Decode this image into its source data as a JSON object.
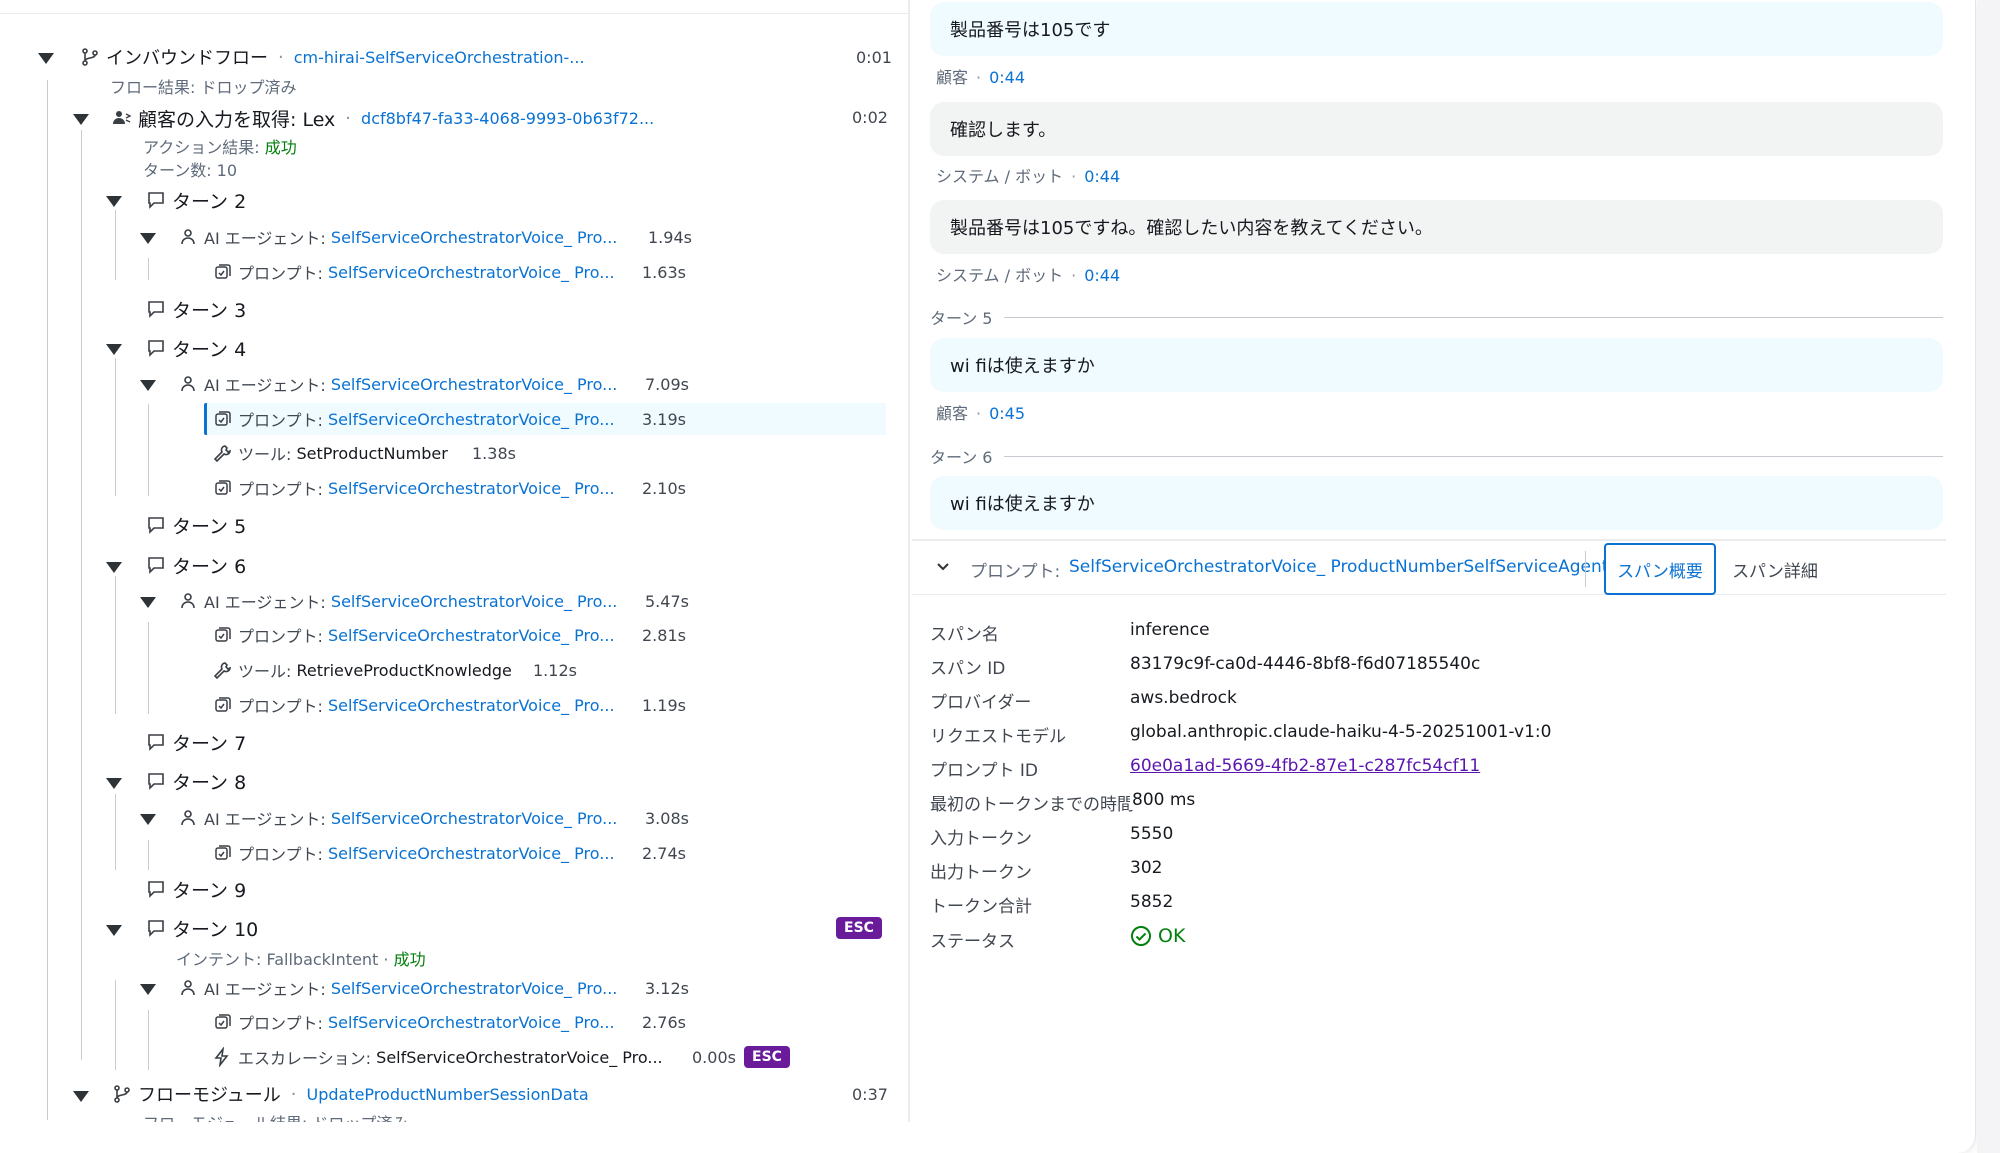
{
  "tree": {
    "inbound": {
      "label": "インバウンドフロー",
      "id": "cm-hirai-SelfServiceOrchestration-...",
      "time": "0:01",
      "result": "フロー結果: ドロップ済み"
    },
    "get_input": {
      "label": "顧客の入力を取得: Lex",
      "id": "dcf8bf47-fa33-4068-9993-0b63f72...",
      "time": "0:02",
      "result_prefix": "アクション結果: ",
      "result_value": "成功",
      "turns": "ターン数: 10"
    },
    "turns": [
      {
        "label": "ターン 2"
      },
      {
        "label": "ターン 3"
      },
      {
        "label": "ターン 4"
      },
      {
        "label": "ターン 5"
      },
      {
        "label": "ターン 6"
      },
      {
        "label": "ターン 7"
      },
      {
        "label": "ターン 8"
      },
      {
        "label": "ターン 9"
      },
      {
        "label": "ターン 10",
        "intent_prefix": "インテント: FallbackIntent · ",
        "intent_value": "成功",
        "badge": "ESC"
      }
    ],
    "agent_label": "AI エージェント:",
    "prompt_label": "プロンプト:",
    "tool_label": "ツール:",
    "escalation_label": "エスカレーション:",
    "agent_name": "SelfServiceOrchestratorVoice_ Pro...",
    "items": {
      "t2_agent": "1.94s",
      "t2_prompt": "1.63s",
      "t4_agent": "7.09s",
      "t4_prompt1": "3.19s",
      "t4_tool": "SetProductNumber",
      "t4_tool_time": "1.38s",
      "t4_prompt2": "2.10s",
      "t6_agent": "5.47s",
      "t6_prompt1": "2.81s",
      "t6_tool": "RetrieveProductKnowledge",
      "t6_tool_time": "1.12s",
      "t6_prompt2": "1.19s",
      "t8_agent": "3.08s",
      "t8_prompt": "2.74s",
      "t10_agent": "3.12s",
      "t10_prompt": "2.76s",
      "t10_esc_name": "SelfServiceOrchestratorVoice_ Pro...",
      "t10_esc_time": "0.00s",
      "t10_esc_badge": "ESC"
    },
    "flow_module": {
      "label": "フローモジュール",
      "id": "UpdateProductNumberSessionData",
      "time": "0:37",
      "result": "フローモジュール結果: ドロップ済み"
    }
  },
  "chat": {
    "m1": {
      "text": "製品番号は105です",
      "who": "顧客",
      "time": "0:44"
    },
    "m2": {
      "text": "確認します。",
      "who": "システム / ボット",
      "time": "0:44"
    },
    "m3": {
      "text": "製品番号は105ですね。確認したい内容を教えてください。",
      "who": "システム / ボット",
      "time": "0:44"
    },
    "turn5": "ターン 5",
    "m4": {
      "text": "wi fiは使えますか",
      "who": "顧客",
      "time": "0:45"
    },
    "turn6": "ターン 6",
    "m5": {
      "text": "wi fiは使えますか"
    }
  },
  "detail": {
    "header_label": "プロンプト:",
    "header_value": "SelfServiceOrchestratorVoice_ ProductNumberSelfServiceAgent",
    "tab_summary": "スパン概要",
    "tab_details": "スパン詳細",
    "rows": [
      {
        "k": "スパン名",
        "v": "inference"
      },
      {
        "k": "スパン ID",
        "v": "83179c9f-ca0d-4446-8bf8-f6d07185540c"
      },
      {
        "k": "プロバイダー",
        "v": "aws.bedrock"
      },
      {
        "k": "リクエストモデル",
        "v": "global.anthropic.claude-haiku-4-5-20251001-v1:0"
      },
      {
        "k": "プロンプト ID",
        "v": "60e0a1ad-5669-4fb2-87e1-c287fc54cf11"
      },
      {
        "k": "最初のトークンまでの時間",
        "v": "800 ms"
      },
      {
        "k": "入力トークン",
        "v": "5550"
      },
      {
        "k": "出力トークン",
        "v": "302"
      },
      {
        "k": "トークン合計",
        "v": "5852"
      },
      {
        "k": "ステータス",
        "v": "OK"
      }
    ],
    "status_color": "#037f0c"
  }
}
